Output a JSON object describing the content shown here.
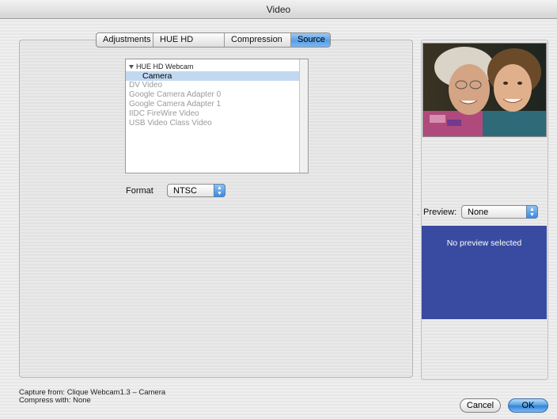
{
  "window": {
    "title": "Video"
  },
  "tabs": [
    {
      "label": "Adjustments",
      "active": false
    },
    {
      "label": "HUE HD Webcam",
      "active": false
    },
    {
      "label": "Compression",
      "active": false
    },
    {
      "label": "Source",
      "active": true
    }
  ],
  "source_list": {
    "group": "HUE HD Webcam",
    "selected": "Camera",
    "items": [
      "DV Video",
      "Google Camera Adapter 0",
      "Google Camera Adapter 1",
      "IIDC FireWire Video",
      "USB Video Class Video"
    ]
  },
  "format": {
    "label": "Format",
    "value": "NTSC"
  },
  "preview": {
    "label": "Preview:",
    "value": "None",
    "message": "No preview selected"
  },
  "status": {
    "capture": "Capture from: Clique Webcam1.3 – Camera",
    "compress": "Compress with: None"
  },
  "buttons": {
    "cancel": "Cancel",
    "ok": "OK"
  },
  "colors": {
    "accent": "#5a9ee6",
    "preview_bg": "#394ba0",
    "selection": "#c2d8f1"
  }
}
